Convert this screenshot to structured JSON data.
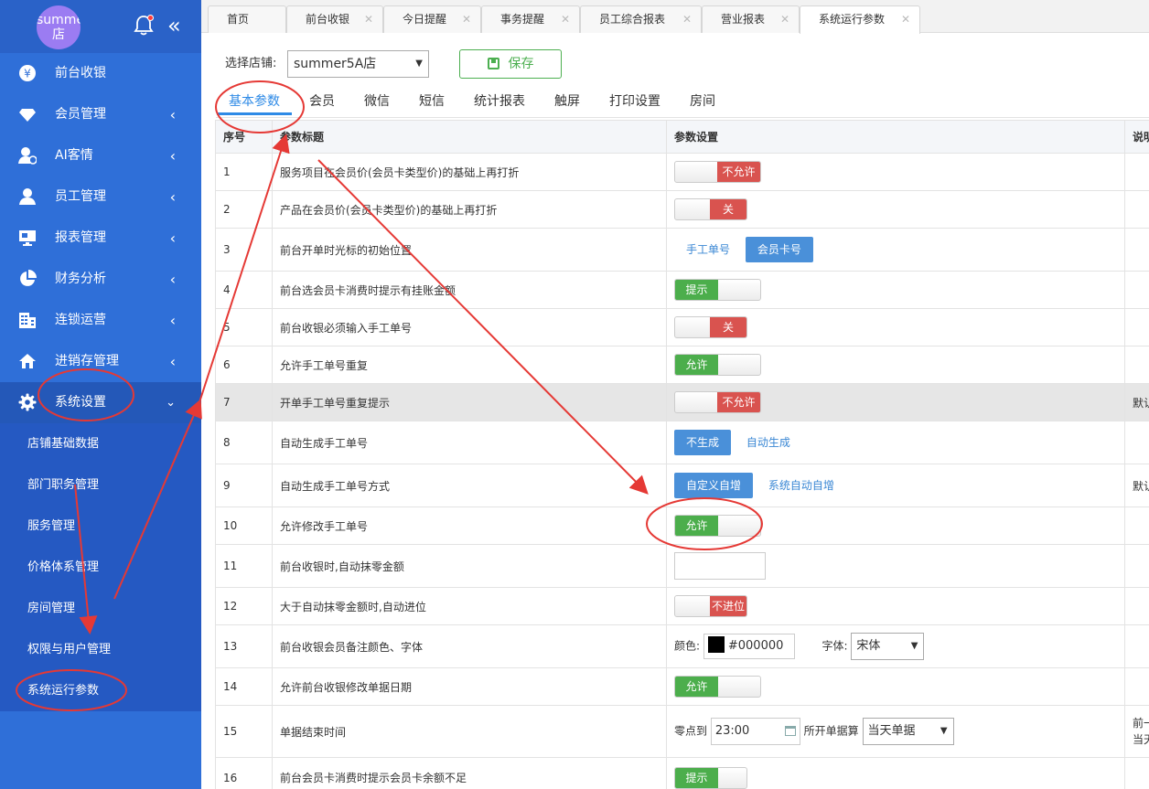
{
  "sidebar": {
    "store_name": "summer5A店",
    "menu": [
      {
        "label": "前台收银",
        "icon": "yen-icon"
      },
      {
        "label": "会员管理",
        "icon": "diamond-icon"
      },
      {
        "label": "AI客情",
        "icon": "user-chat-icon"
      },
      {
        "label": "员工管理",
        "icon": "user-icon"
      },
      {
        "label": "报表管理",
        "icon": "monitor-icon"
      },
      {
        "label": "财务分析",
        "icon": "pie-chart-icon"
      },
      {
        "label": "连锁运营",
        "icon": "building-icon"
      },
      {
        "label": "进销存管理",
        "icon": "house-icon"
      },
      {
        "label": "系统设置",
        "icon": "gear-icon"
      }
    ],
    "submenu": [
      "店铺基础数据",
      "部门职务管理",
      "服务管理",
      "价格体系管理",
      "房间管理",
      "权限与用户管理",
      "系统运行参数"
    ]
  },
  "tabs": [
    {
      "label": "首页"
    },
    {
      "label": "前台收银"
    },
    {
      "label": "今日提醒"
    },
    {
      "label": "事务提醒"
    },
    {
      "label": "员工综合报表"
    },
    {
      "label": "营业报表"
    },
    {
      "label": "系统运行参数"
    }
  ],
  "form": {
    "store_label": "选择店铺:",
    "store_value": "summer5A店",
    "save_label": "保存"
  },
  "subtabs": [
    "基本参数",
    "会员",
    "微信",
    "短信",
    "统计报表",
    "触屏",
    "打印设置",
    "房间"
  ],
  "table": {
    "headers": [
      "序号",
      "参数标题",
      "参数设置",
      "说明"
    ],
    "rows": [
      {
        "no": "1",
        "title": "服务项目在会员价(会员卡类型价)的基础上再打折",
        "off": "不允许",
        "note": ""
      },
      {
        "no": "2",
        "title": "产品在会员价(会员卡类型价)的基础上再打折",
        "off": "关",
        "note": ""
      },
      {
        "no": "3",
        "title": "前台开单时光标的初始位置",
        "opt_a": "手工单号",
        "opt_b": "会员卡号",
        "note": ""
      },
      {
        "no": "4",
        "title": "前台选会员卡消费时提示有挂账金额",
        "on": "提示",
        "note": ""
      },
      {
        "no": "5",
        "title": "前台收银必须输入手工单号",
        "off": "关",
        "note": ""
      },
      {
        "no": "6",
        "title": "允许手工单号重复",
        "on": "允许",
        "note": ""
      },
      {
        "no": "7",
        "title": "开单手工单号重复提示",
        "off": "不允许",
        "note": "默认"
      },
      {
        "no": "8",
        "title": "自动生成手工单号",
        "opt_a": "不生成",
        "opt_b": "自动生成",
        "note": ""
      },
      {
        "no": "9",
        "title": "自动生成手工单号方式",
        "opt_a": "自定义自增",
        "opt_b": "系统自动自增",
        "note": "默认"
      },
      {
        "no": "10",
        "title": "允许修改手工单号",
        "on": "允许",
        "note": ""
      },
      {
        "no": "11",
        "title": "前台收银时,自动抹零金额",
        "note": ""
      },
      {
        "no": "12",
        "title": "大于自动抹零金额时,自动进位",
        "off": "不进位",
        "note": ""
      },
      {
        "no": "13",
        "title": "前台收银会员备注颜色、字体",
        "color_label": "颜色:",
        "color_value": "#000000",
        "font_label": "字体:",
        "font_value": "宋体",
        "note": ""
      },
      {
        "no": "14",
        "title": "允许前台收银修改单据日期",
        "on": "允许",
        "note": ""
      },
      {
        "no": "15",
        "title": "单据结束时间",
        "time_label": "零点到",
        "time_value": "23:00",
        "bill_label": "所开单据算",
        "bill_value": "当天单据",
        "note": "前一",
        "note2": "当天"
      },
      {
        "no": "16",
        "title": "前台会员卡消费时提示会员卡余额不足",
        "on": "提示",
        "note": ""
      }
    ]
  },
  "colors": {
    "sidebar": "#2f6fd8",
    "toggle_on": "#4cae4c",
    "toggle_off": "#d9534f",
    "accent": "#2e8ae6",
    "annotation": "#e53935"
  }
}
